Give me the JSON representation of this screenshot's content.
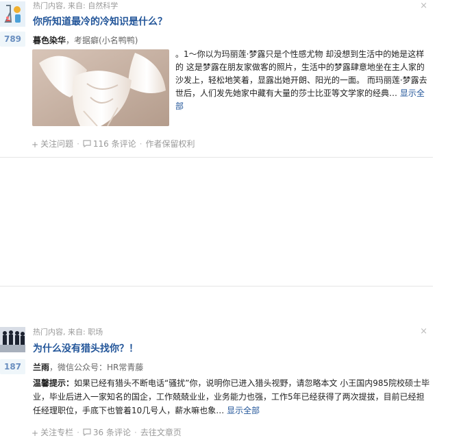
{
  "items": [
    {
      "meta": "热门内容, 来自: 自然科学",
      "title": "你所知道最冷的冷知识是什么？",
      "votes": "789",
      "author_name": "暮色染华",
      "author_bio": "，考据癖(小名鸭鸭)",
      "summary": "。1～你以为玛丽莲·梦露只是个性感尤物 却没想到生活中的她是这样的 这是梦露在朋友家做客的照片，生活中的梦露肆意地坐在主人家的沙发上，轻松地笑着，显露出她开朗、阳光的一面。 而玛丽莲·梦露去世后，人们发先她家中藏有大量的莎士比亚等文学家的经典…",
      "more": "显示全部",
      "follow": "关注问题",
      "comments": "116 条评论",
      "rights": "作者保留权利"
    },
    {
      "meta": "热门内容, 来自: 职场",
      "title": "为什么没有猎头找你？！",
      "votes": "187",
      "author_name": "兰雨",
      "author_bio": "，微信公众号：HR常青藤",
      "summary_hint": "温馨提示：",
      "summary": "如果已经有猎头不断电话“骚扰”你，说明你已进入猎头视野，请忽略本文 小王国内985院校硕士毕业，毕业后进入一家知名的国企，工作兢兢业业，业务能力也强，工作5年已经获得了两次提拔，目前已经担任经理职位，手底下也管着10几号人，薪水嘛也象…",
      "more": "显示全部",
      "follow": "关注专栏",
      "comments": "36 条评论",
      "rights": "去往文章页"
    }
  ],
  "close_glyph": "×",
  "colors": {
    "link": "#225599",
    "vote_bg": "#eff6fa",
    "vote_text": "#698ebf",
    "meta": "#999999"
  },
  "icons": [
    "science-topic-icon",
    "career-topic-icon",
    "plus-icon",
    "comment-icon",
    "lock-icon",
    "share-icon"
  ]
}
